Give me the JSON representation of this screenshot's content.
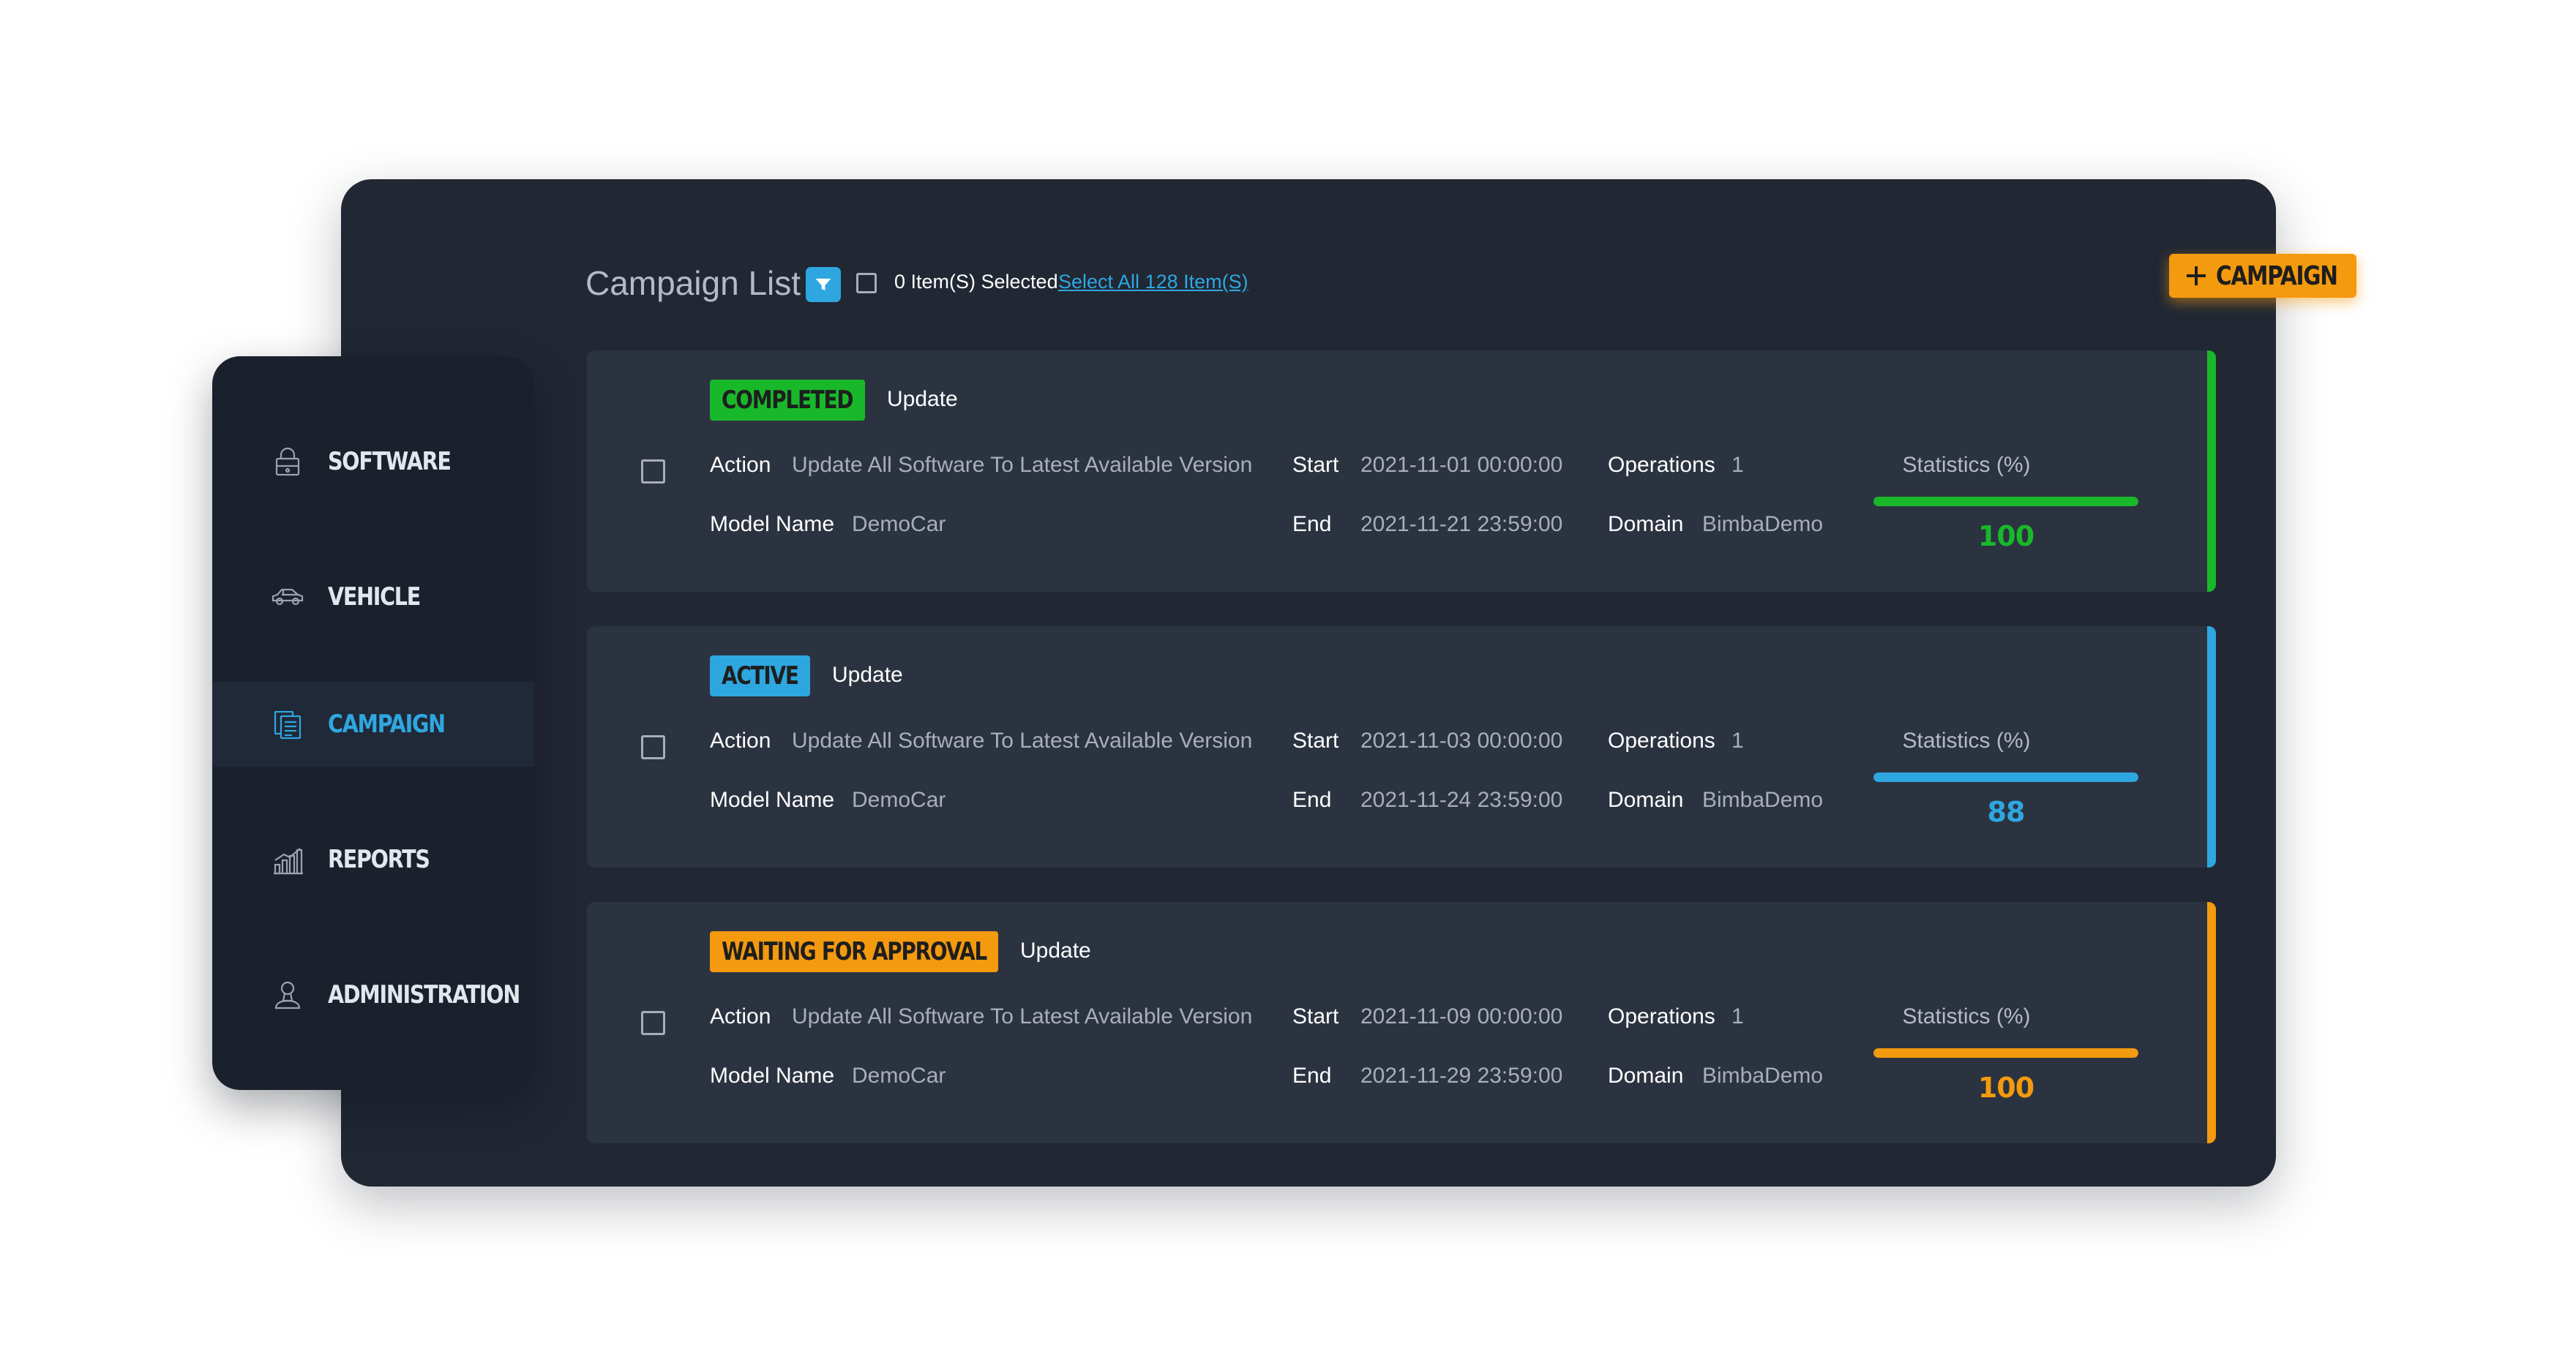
{
  "colors": {
    "completed": "#19b82a",
    "active": "#2ea7e0",
    "waiting": "#f49a0e"
  },
  "sidebar": {
    "items": [
      {
        "label": "SOFTWARE",
        "icon": "lock-software-icon",
        "active": false
      },
      {
        "label": "VEHICLE",
        "icon": "car-icon",
        "active": false
      },
      {
        "label": "CAMPAIGN",
        "icon": "documents-icon",
        "active": true
      },
      {
        "label": "REPORTS",
        "icon": "bar-chart-icon",
        "active": false
      },
      {
        "label": "ADMINISTRATION",
        "icon": "user-admin-icon",
        "active": false
      }
    ]
  },
  "header": {
    "title": "Campaign List",
    "filter_icon": "filter-icon",
    "selected_text": "0 Item(S) Selected",
    "select_all": "Select All 128 Item(S)",
    "add_button": "CAMPAIGN",
    "add_icon": "plus-icon"
  },
  "campaigns": [
    {
      "status": "COMPLETED",
      "status_key": "completed",
      "type": "Update",
      "action_label": "Action",
      "action": "Update All Software To Latest Available Version",
      "model_label": "Model Name",
      "model": "DemoCar",
      "start_label": "Start",
      "start": "2021-11-01 00:00:00",
      "end_label": "End",
      "end": "2021-11-21 23:59:00",
      "operations_label": "Operations",
      "operations": "1",
      "domain_label": "Domain",
      "domain": "BimbaDemo",
      "stats_label": "Statistics (%)",
      "stats": "100",
      "progress": 1.0
    },
    {
      "status": "ACTIVE",
      "status_key": "active",
      "type": "Update",
      "action_label": "Action",
      "action": "Update All Software To Latest Available Version",
      "model_label": "Model Name",
      "model": "DemoCar",
      "start_label": "Start",
      "start": "2021-11-03 00:00:00",
      "end_label": "End",
      "end": "2021-11-24 23:59:00",
      "operations_label": "Operations",
      "operations": "1",
      "domain_label": "Domain",
      "domain": "BimbaDemo",
      "stats_label": "Statistics (%)",
      "stats": "88",
      "progress": 1.0
    },
    {
      "status": "WAITING FOR APPROVAL",
      "status_key": "waiting",
      "type": "Update",
      "action_label": "Action",
      "action": "Update All Software To Latest Available Version",
      "model_label": "Model Name",
      "model": "DemoCar",
      "start_label": "Start",
      "start": "2021-11-09 00:00:00",
      "end_label": "End",
      "end": "2021-11-29 23:59:00",
      "operations_label": "Operations",
      "operations": "1",
      "domain_label": "Domain",
      "domain": "BimbaDemo",
      "stats_label": "Statistics (%)",
      "stats": "100",
      "progress": 1.0
    }
  ]
}
